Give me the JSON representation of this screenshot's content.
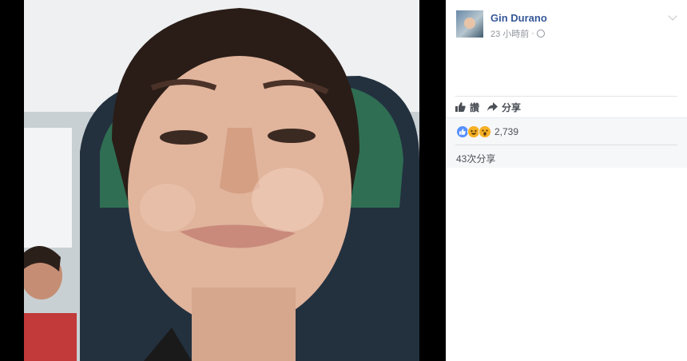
{
  "post": {
    "author": "Gin Durano",
    "time": "23 小時前",
    "separator": "·",
    "visibility_icon": "globe-icon"
  },
  "actions": {
    "like_label": "讚",
    "share_label": "分享"
  },
  "reactions": {
    "types": [
      "like",
      "haha",
      "wow"
    ],
    "count": "2,739"
  },
  "shares": {
    "label": "43次分享"
  }
}
